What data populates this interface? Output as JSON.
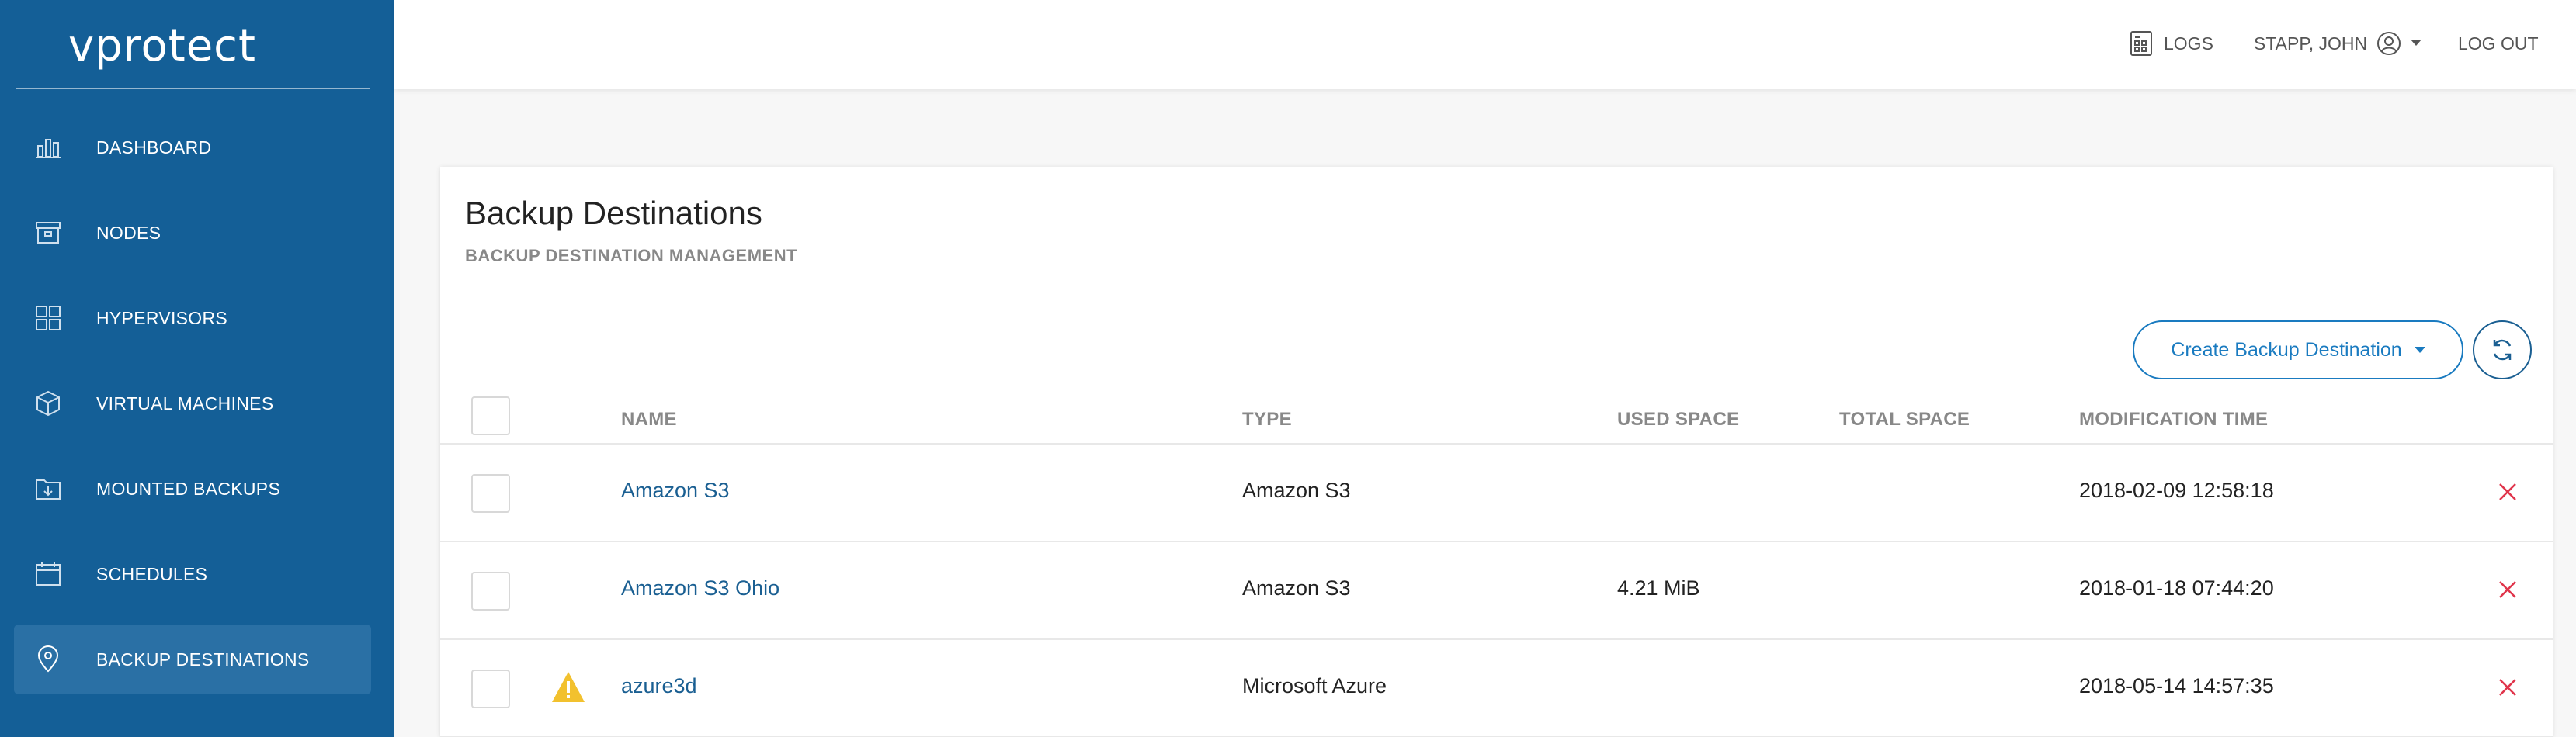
{
  "brand": {
    "logo": "vprotect"
  },
  "sidebar": {
    "items": [
      {
        "label": "DASHBOARD",
        "icon": "bar-chart-icon",
        "active": false
      },
      {
        "label": "NODES",
        "icon": "archive-box-icon",
        "active": false
      },
      {
        "label": "HYPERVISORS",
        "icon": "grid-icon",
        "active": false
      },
      {
        "label": "VIRTUAL MACHINES",
        "icon": "cube-icon",
        "active": false
      },
      {
        "label": "MOUNTED BACKUPS",
        "icon": "folder-download-icon",
        "active": false
      },
      {
        "label": "SCHEDULES",
        "icon": "calendar-icon",
        "active": false
      },
      {
        "label": "BACKUP DESTINATIONS",
        "icon": "location-pin-icon",
        "active": true
      }
    ]
  },
  "topbar": {
    "logs_label": "LOGS",
    "user_label": "STAPP, JOHN",
    "logout_label": "LOG OUT"
  },
  "page": {
    "title": "Backup Destinations",
    "subtitle": "BACKUP DESTINATION MANAGEMENT",
    "create_button_label": "Create Backup Destination"
  },
  "table": {
    "columns": {
      "name": "NAME",
      "type": "TYPE",
      "used_space": "USED SPACE",
      "total_space": "TOTAL SPACE",
      "modification_time": "MODIFICATION TIME"
    },
    "rows": [
      {
        "name": "Amazon S3",
        "type": "Amazon S3",
        "used_space": "",
        "total_space": "",
        "modification_time": "2018-02-09 12:58:18",
        "warning": false
      },
      {
        "name": "Amazon S3 Ohio",
        "type": "Amazon S3",
        "used_space": "4.21 MiB",
        "total_space": "",
        "modification_time": "2018-01-18 07:44:20",
        "warning": false
      },
      {
        "name": "azure3d",
        "type": "Microsoft Azure",
        "used_space": "",
        "total_space": "",
        "modification_time": "2018-05-14 14:57:35",
        "warning": true
      }
    ]
  },
  "colors": {
    "sidebar_bg": "#145f97",
    "sidebar_active": "#2a70a5",
    "accent": "#1a7bc0",
    "link": "#1a5f92",
    "delete": "#e0344b",
    "warning": "#f2c12e"
  }
}
